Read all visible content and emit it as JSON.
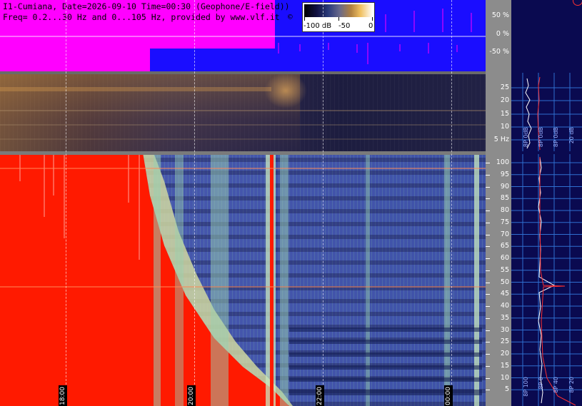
{
  "header": {
    "title": "I1-Cumiana, Date=2026-09-10 Time=00:30 (Geophone/E-field))",
    "freq": "Freq= 0.2...30 Hz and 0...105 Hz, provided by www.vlf.it",
    "copyright": "©"
  },
  "colorbar": {
    "labels": [
      "-100 dB",
      "-50",
      "0"
    ]
  },
  "amplitude_scale": {
    "labels": [
      "50 %",
      "0 %",
      "-50 %"
    ]
  },
  "mid_scale": {
    "labels": [
      "25",
      "20",
      "15",
      "10",
      "5 Hz"
    ]
  },
  "low_scale": {
    "labels": [
      "100",
      "95",
      "90",
      "85",
      "80",
      "75",
      "70",
      "65",
      "60",
      "55",
      "50",
      "45",
      "40",
      "35",
      "30",
      "25",
      "20",
      "15",
      "10",
      "5"
    ]
  },
  "time_markers": [
    "18:00",
    "20:00",
    "22:00",
    "00:00"
  ],
  "side_labels": {
    "mid": [
      "8P 0dB",
      "8P 0dB",
      "8P 0dB",
      "8P 0dB",
      "20 dB"
    ],
    "low": [
      "8P 100",
      "8P 0",
      "8P 0dB",
      "8P 40",
      "8P 20"
    ]
  },
  "colors": {
    "amplitude_magenta": "#ff00ff",
    "amplitude_blue": "#1a0dff",
    "intense_red": "#ff1a00",
    "side_background": "#0a0a50",
    "scale_grey": "#8c8c8c"
  }
}
